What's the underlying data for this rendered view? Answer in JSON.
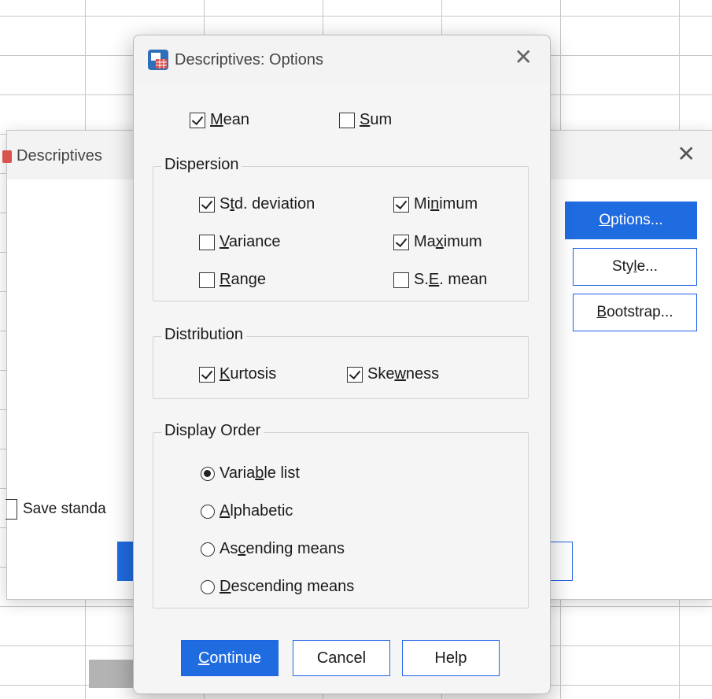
{
  "background_window": {
    "title": "Descriptives",
    "buttons": [
      "Options...",
      "Style...",
      "Bootstrap..."
    ],
    "save_label": "Save standa"
  },
  "dialog": {
    "title": "Descriptives: Options",
    "mean_label": "Mean",
    "sum_label": "Sum",
    "dispersion": {
      "title": "Dispersion",
      "std": "Std. deviation",
      "variance": "Variance",
      "range": "Range",
      "minimum": "Minimum",
      "maximum": "Maximum",
      "se_mean": "S.E. mean"
    },
    "distribution": {
      "title": "Distribution",
      "kurtosis": "Kurtosis",
      "skewness": "Skewness"
    },
    "display_order": {
      "title": "Display Order",
      "options": [
        "Variable list",
        "Alphabetic",
        "Ascending means",
        "Descending means"
      ],
      "selected": "Variable list"
    },
    "buttons": {
      "continue": "Continue",
      "cancel": "Cancel",
      "help": "Help"
    }
  }
}
